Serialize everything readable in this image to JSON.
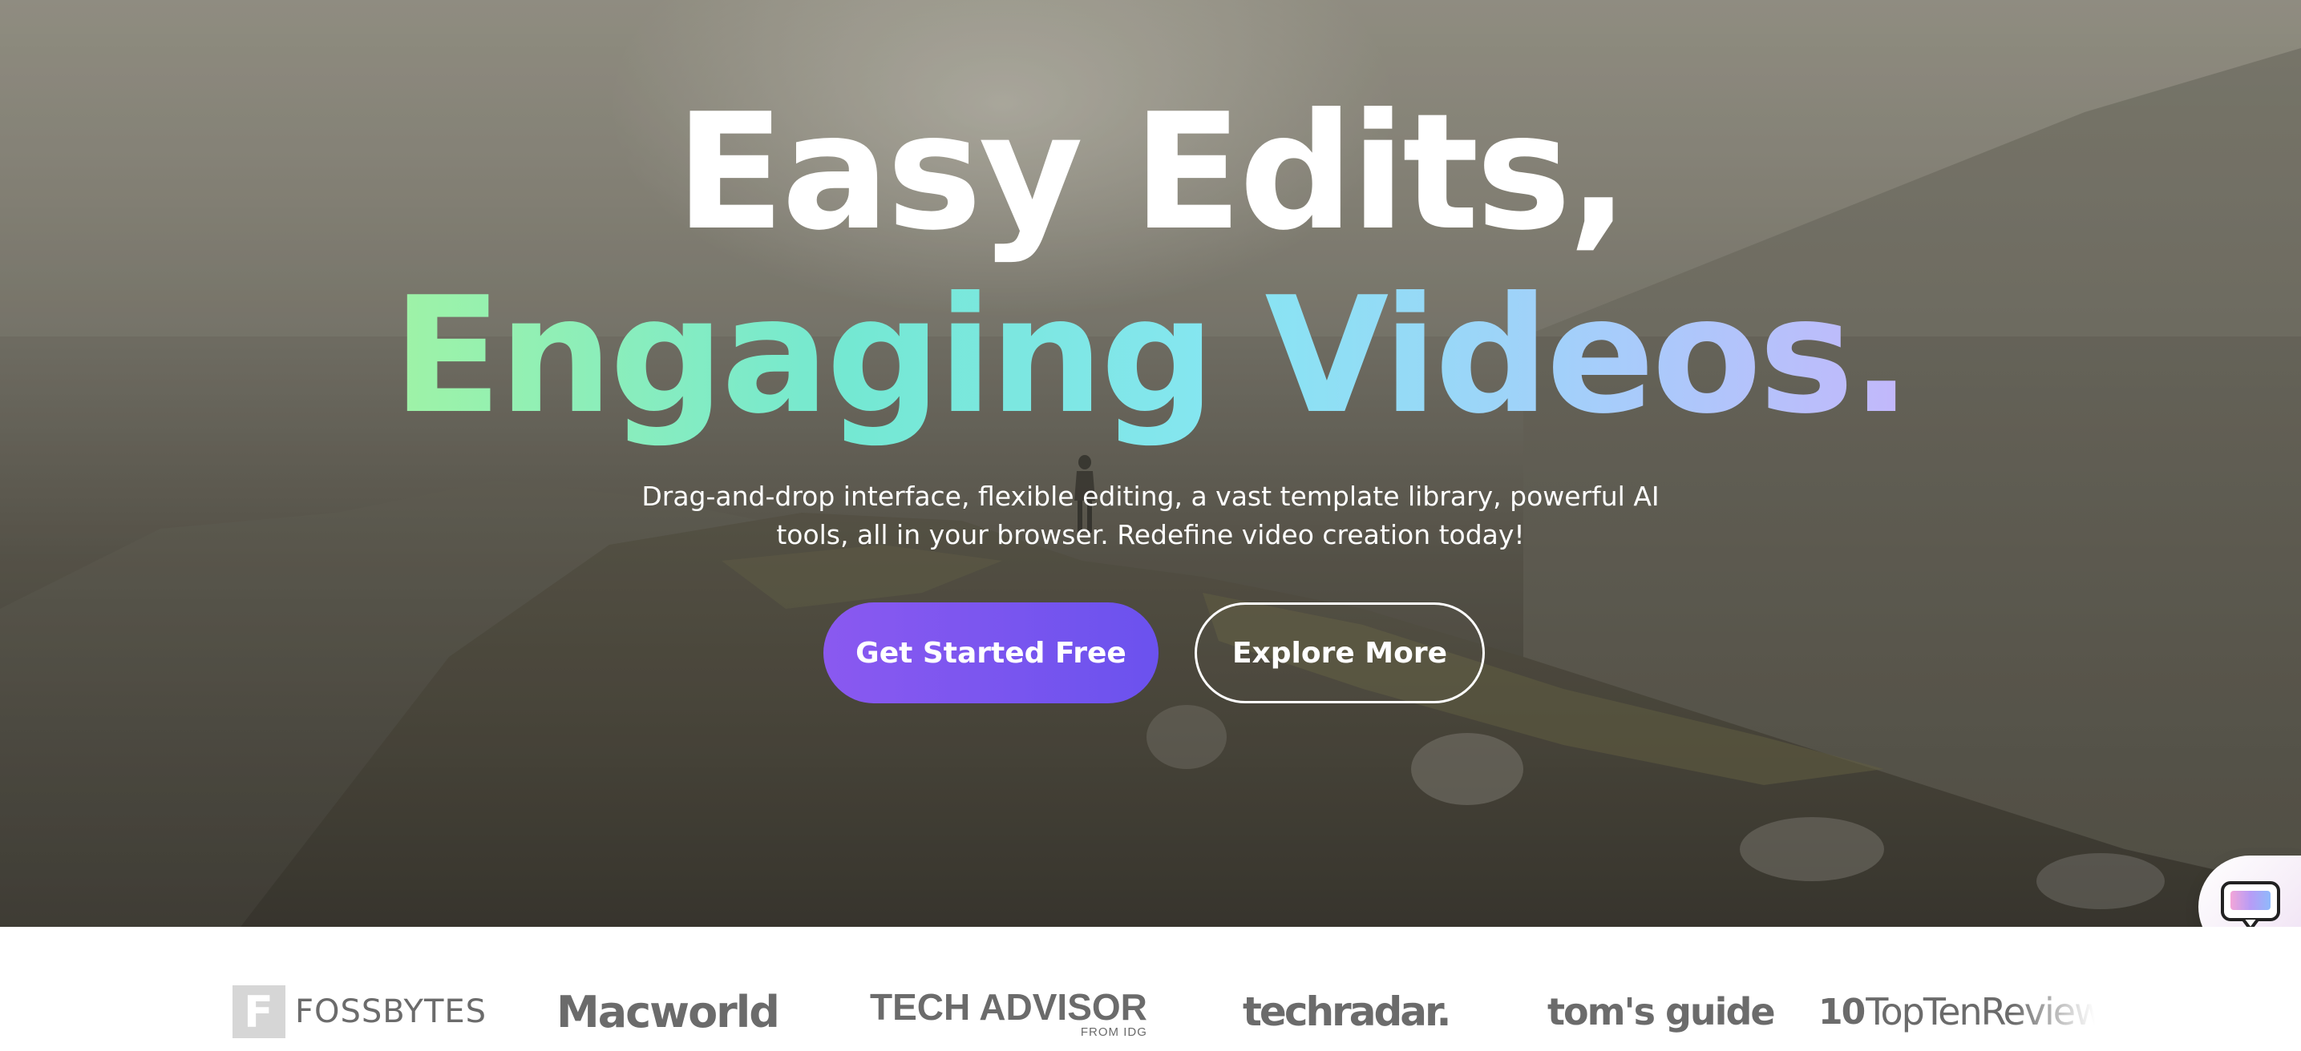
{
  "hero": {
    "headline_line1": "Easy Edits,",
    "headline_line2": "Engaging Videos.",
    "subtitle": "Drag-and-drop interface, flexible editing, a vast template library, powerful AI tools, all in your browser. Redefine video creation today!",
    "primary_button_label": "Get Started Free",
    "secondary_button_label": "Explore More",
    "headline_gradient_colors": [
      "#9ff3a6",
      "#74e8d2",
      "#86e6f2",
      "#a6cdfb",
      "#c3b7fb"
    ],
    "primary_button_color": "#7a56ef",
    "background_description_icon": "mountain-video-background"
  },
  "chat_widget": {
    "icon": "chat-bubble-icon"
  },
  "press_logos": {
    "fossbytes": {
      "mark": "F",
      "name": "FOSSBYTES"
    },
    "macworld": {
      "name": "Macworld"
    },
    "techadvisor": {
      "name": "TECH ADVISOR",
      "sub": "FROM IDG"
    },
    "techradar": {
      "name": "techradar."
    },
    "tomsguide": {
      "name": "tom's guide"
    },
    "toptenreviews": {
      "mark": "10",
      "name": "TopTenReviews"
    }
  }
}
